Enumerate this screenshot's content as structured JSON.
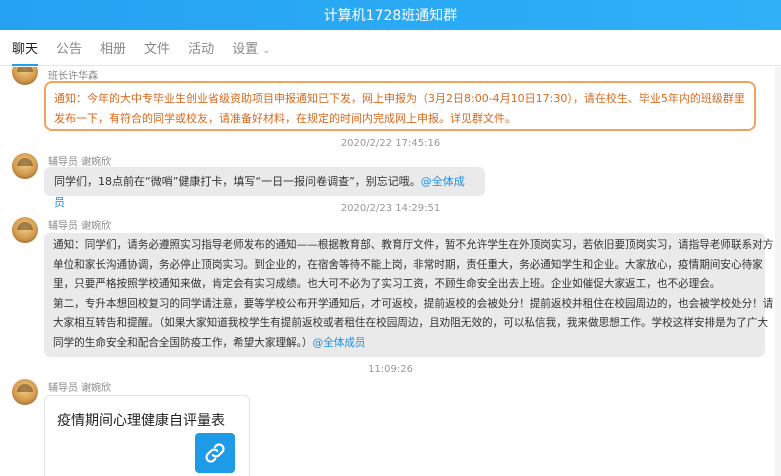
{
  "window": {
    "title": "计算机1728班通知群"
  },
  "tabs": [
    {
      "label": "聊天"
    },
    {
      "label": "公告"
    },
    {
      "label": "相册"
    },
    {
      "label": "文件"
    },
    {
      "label": "活动"
    },
    {
      "label": "设置"
    }
  ],
  "messages": {
    "m1": {
      "sender": "班长许华森",
      "text": "通知：今年的大中专毕业生创业省级资助项目申报通知已下发，网上申报为（3月2日8:00-4月10日17:30），请在校生、毕业5年内的班级群里发布一下，有符合的同学或校友，请准备好材料，在规定的时间内完成网上申报。详见群文件。"
    },
    "ts1": "2020/2/22 17:45:16",
    "m2": {
      "sender": "辅导员 谢婉欣",
      "text": "同学们，18点前在“微哨”健康打卡，填写“一日一报问卷调查”，别忘记哦。",
      "mention": "@全体成员"
    },
    "ts2": "2020/2/23 14:29:51",
    "m3": {
      "sender": "辅导员 谢婉欣",
      "line1": "通知：同学们，请务必遵照实习指导老师发布的通知——根据教育部、教育厅文件，暂不允许学生在外顶岗实习，若依旧要顶岗实习，请指导老师联系对方",
      "line2": "单位和家长沟通协调，务必停止顶岗实习。到企业的，在宿舍等待不能上岗，非常时期，责任重大，务必通知学生和企业。大家放心，疫情期间安心待家",
      "line3": "里，只要严格按照学校通知来做，肯定会有实习成绩。也大可不必为了实习工资，不顾生命安全出去上班。企业如催促大家返工，也不必理会。",
      "line4": "第二，专升本想回校复习的同学请注意，要等学校公布开学通知后，才可返校，提前返校的会被处分！提前返校并租住在校园周边的，也会被学校处分！请",
      "line5": "大家相互转告和提醒。（如果大家知道我校学生有提前返校或者租住在校园周边，且劝阻无效的，可以私信我，我来做思想工作。学校这样安排是为了广大",
      "line6": "同学的生命安全和配合全国防疫工作，希望大家理解。）",
      "mention": "@全体成员"
    },
    "ts3": "11:09:26",
    "m4": {
      "sender": "辅导员 谢婉欣",
      "card_title": "疫情期间心理健康自评量表"
    }
  },
  "colors": {
    "accent": "#1f9ef0",
    "notice_border": "#f2a35e",
    "notice_text": "#d8691c",
    "mention": "#1f8fe8"
  },
  "icons": {
    "avatar": "avatar-icon",
    "settings_chevron": "chevron-down-icon",
    "card_link": "link-icon"
  }
}
